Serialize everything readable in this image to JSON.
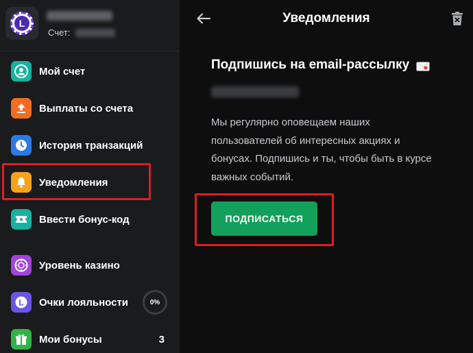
{
  "sidebar": {
    "account_label": "Счет:",
    "items": [
      {
        "label": "Мой счет",
        "icon": "user-icon",
        "color": "#17b2a2"
      },
      {
        "label": "Выплаты со счета",
        "icon": "upload-icon",
        "color": "#f26c21"
      },
      {
        "label": "История транзакций",
        "icon": "clock-icon",
        "color": "#2a7ae8"
      },
      {
        "label": "Уведомления",
        "icon": "bell-icon",
        "color": "#f6a31a",
        "active": true
      },
      {
        "label": "Ввести бонус-код",
        "icon": "ticket-icon",
        "color": "#17b2a2"
      },
      {
        "label": "Уровень казино",
        "icon": "roulette-icon",
        "color": "#a243d9"
      },
      {
        "label": "Очки лояльности",
        "icon": "loyalty-icon",
        "color": "#6a55e6",
        "progress": "0%"
      },
      {
        "label": "Мои бонусы",
        "icon": "gift-icon",
        "color": "#2fb545",
        "count": "3"
      }
    ]
  },
  "header": {
    "title": "Уведомления"
  },
  "main": {
    "heading": "Подпишись на email-рассылку",
    "description": "Мы регулярно оповещаем наших пользователей об интересных акциях и бонусах. Подпишись и ты, чтобы быть в курсе важных событий.",
    "subscribe_label": "ПОДПИСАТЬСЯ"
  },
  "colors": {
    "sidebar_bg": "#1a1b1d",
    "main_bg": "#0e0e0f",
    "accent_green": "#13a05a",
    "highlight_red": "#e31b23"
  }
}
